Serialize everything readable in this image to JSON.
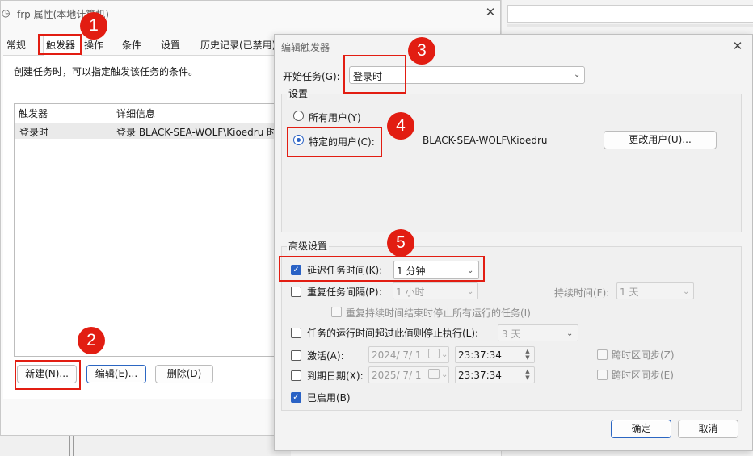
{
  "properties_window": {
    "title": "frp 属性(本地计算机)",
    "title_icon": "clock-icon",
    "tabs": [
      "常规",
      "触发器",
      "操作",
      "条件",
      "设置",
      "历史记录(已禁用)"
    ],
    "active_tab": "触发器",
    "description": "创建任务时，可以指定触发该任务的条件。",
    "table": {
      "columns": [
        "触发器",
        "详细信息"
      ],
      "rows": [
        {
          "trigger": "登录时",
          "details": "登录 BLACK-SEA-WOLF\\Kioedru 时"
        }
      ]
    },
    "buttons": {
      "new": "新建(N)...",
      "edit": "编辑(E)...",
      "delete": "删除(D)"
    }
  },
  "edit_trigger_dialog": {
    "title": "编辑触发器",
    "begin_task_label": "开始任务(G):",
    "begin_task_value": "登录时",
    "settings_group_label": "设置",
    "radio_all_users": "所有用户(Y)",
    "radio_specific_user": "特定的用户(C):",
    "selected_radio": "specific_user",
    "user_name": "BLACK-SEA-WOLF\\Kioedru",
    "change_user_button": "更改用户(U)...",
    "advanced_group_label": "高级设置",
    "delay": {
      "label": "延迟任务时间(K):",
      "checked": true,
      "value": "1 分钟"
    },
    "repeat": {
      "label": "重复任务间隔(P):",
      "checked": false,
      "value": "1 小时",
      "duration_label": "持续时间(F):",
      "duration_value": "1 天"
    },
    "stop_all_at_end": {
      "label": "重复持续时间结束时停止所有运行的任务(I)",
      "checked": false
    },
    "stop_if_longer": {
      "label": "任务的运行时间超过此值则停止执行(L):",
      "checked": false,
      "value": "3 天"
    },
    "activate": {
      "label": "激活(A):",
      "checked": false,
      "date": "2024/  7/  1",
      "time": "23:37:34",
      "sync_label": "跨时区同步(Z)"
    },
    "expire": {
      "label": "到期日期(X):",
      "checked": false,
      "date": "2025/  7/  1",
      "time": "23:37:34",
      "sync_label": "跨时区同步(E)"
    },
    "enabled": {
      "label": "已启用(B)",
      "checked": true
    },
    "ok_button": "确定",
    "cancel_button": "取消"
  },
  "annotations": {
    "step_1": "1",
    "step_2": "2",
    "step_3": "3",
    "step_4": "4",
    "step_5": "5",
    "color": "#e21d12"
  },
  "colors": {
    "accent": "#2a62c5",
    "annotation": "#e21d12"
  }
}
